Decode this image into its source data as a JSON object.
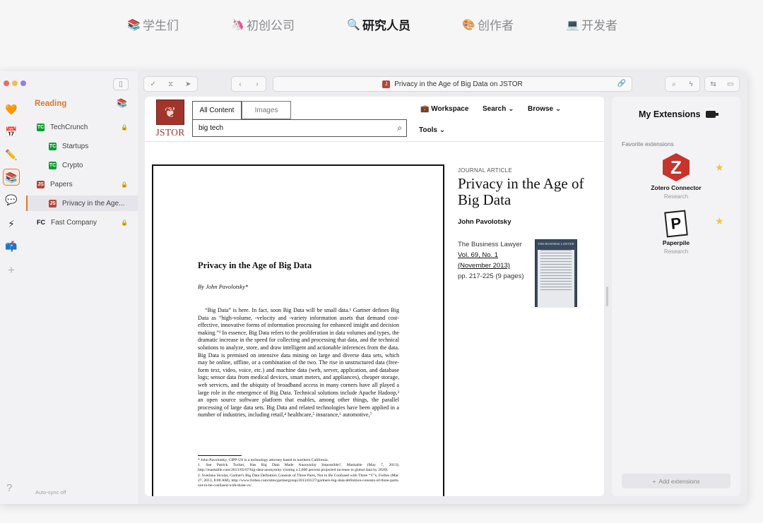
{
  "topnav": {
    "items": [
      {
        "emoji": "📚",
        "label": "学生们"
      },
      {
        "emoji": "🦄",
        "label": "初创公司"
      },
      {
        "emoji": "🔍",
        "label": "研究人员"
      },
      {
        "emoji": "🎨",
        "label": "创作者"
      },
      {
        "emoji": "💻",
        "label": "开发者"
      }
    ],
    "active_index": 2
  },
  "sidebar": {
    "rail_icons": [
      "heart-icon",
      "calendar-icon",
      "pencil-icon",
      "books-icon",
      "chat-icon",
      "bolt-icon",
      "mailbox-icon",
      "plus-icon"
    ],
    "rail_glyphs": [
      "🧡",
      "📅",
      "✏️",
      "📚",
      "💬",
      "⚡",
      "📫",
      "+"
    ],
    "section_title": "Reading",
    "section_icon": "📚",
    "items": [
      {
        "label": "TechCrunch",
        "favicon": "TC"
      },
      {
        "label": "Startups",
        "favicon": "TC"
      },
      {
        "label": "Crypto",
        "favicon": "TC"
      },
      {
        "label": "Papers",
        "favicon": "JS"
      },
      {
        "label": "Privacy in the Age...",
        "favicon": "JS"
      },
      {
        "label": "Fast Company",
        "favicon": "FC"
      }
    ],
    "help_glyph": "?",
    "autosync": "Auto-sync off"
  },
  "toolbar": {
    "page_title": "Privacy in the Age of Big Data on JSTOR"
  },
  "jstor": {
    "logo_text": "JSTOR",
    "tab_all": "All Content",
    "tab_images": "Images",
    "search_value": "big tech",
    "menu": {
      "workspace": "Workspace",
      "search": "Search",
      "browse": "Browse",
      "tools": "Tools"
    }
  },
  "paper": {
    "title": "Privacy in the Age of Big Data",
    "author": "By John Pavolotsky*",
    "body": "“Big Data” is here. In fact, soon Big Data will be small data.¹ Gartner defines Big Data as “high-volume, -velocity and -variety information assets that demand cost-effective, innovative forms of information processing for enhanced insight and decision making.”² In essence, Big Data refers to the proliferation in data volumes and types, the dramatic increase in the speed for collecting and processing that data, and the technical solutions to analyze, store, and draw intelligent and actionable inferences from the data. Big Data is premised on intensive data mining on large and diverse data sets, which may be online, offline, or a combination of the two. The rise in unstructured data (free-form text, video, voice, etc.) and machine data (web, server, application, and database logs; sensor data from medical devices, smart meters, and appliances), cheaper storage, web services, and the ubiquity of broadband access in many corners have all played a large role in the emergence of Big Data. Technical solutions include Apache Hadoop,³ an open source software platform that enables, among other things, the parallel processing of large data sets. Big Data and related technologies have been applied in a number of industries, including retail,⁴ healthcare,⁵ insurance,⁶ automotive,⁷",
    "footnotes": [
      "* John Pavolotsky, CIPP-US is a technology attorney based in northern California.",
      "1. See Patrick Tucker, Has Big Data Made Anonymity Impossible?, Mashable (May 7, 2013), http://mashable.com/2013/05/07/big-data-anonymity/ (noting a 2,000 percent projected increase in global data by 2020).",
      "2. Svetlana Sicular, Gartner's Big Data Definition Consists of Three Parts, Not to Be Confused with Three “V”s, Forbes (Mar. 27, 2013, 8:00 AM), http://www.forbes.com/sites/gartnergroup/2013/03/27/gartners-big-data-definition-consists-of-three-parts-not-to-be-confused-with-three-vs/."
    ]
  },
  "meta": {
    "label": "JOURNAL ARTICLE",
    "title": "Privacy in the Age of Big Data",
    "author": "John Pavolotsky",
    "journal": "The Business Lawyer",
    "volume": "Vol. 69, No. 1",
    "date": "(November 2013)",
    "pages": "pp. 217-225 (9 pages)",
    "cover_title": "THE BUSINESS LAWYER"
  },
  "extensions": {
    "title": "My Extensions",
    "subtitle": "Favorite extensions",
    "items": [
      {
        "name": "Zotero Connector",
        "category": "Research",
        "logo": "Z"
      },
      {
        "name": "Paperpile",
        "category": "Research",
        "logo": "P"
      }
    ],
    "add_label": "Add extensions"
  }
}
